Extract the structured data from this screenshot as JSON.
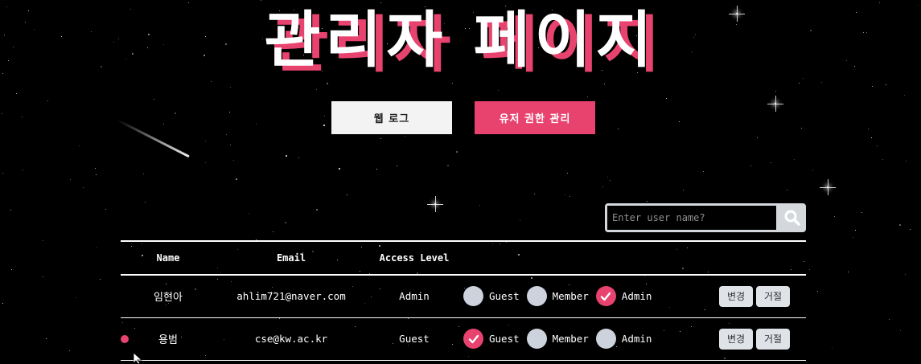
{
  "page": {
    "title": "관리자 페이지"
  },
  "nav": {
    "web_log": "웹 로그",
    "user_permissions": "유저 권한 관리"
  },
  "search": {
    "placeholder": "Enter user name?",
    "icon": "search-icon"
  },
  "table": {
    "headers": [
      "Name",
      "Email",
      "Access Level"
    ],
    "rows": [
      {
        "name": "임현아",
        "email": "ahlim721@naver.com",
        "access": "Admin",
        "selected": "Admin",
        "active": false
      },
      {
        "name": "용범",
        "email": "cse@kw.ac.kr",
        "access": "Guest",
        "selected": "Guest",
        "active": true
      }
    ],
    "options": [
      "Guest",
      "Member",
      "Admin"
    ],
    "change_label": "변경",
    "reject_label": "거절"
  },
  "colors": {
    "accent": "#e8436f",
    "radio_off": "#cdd3dc",
    "background": "#000000"
  }
}
